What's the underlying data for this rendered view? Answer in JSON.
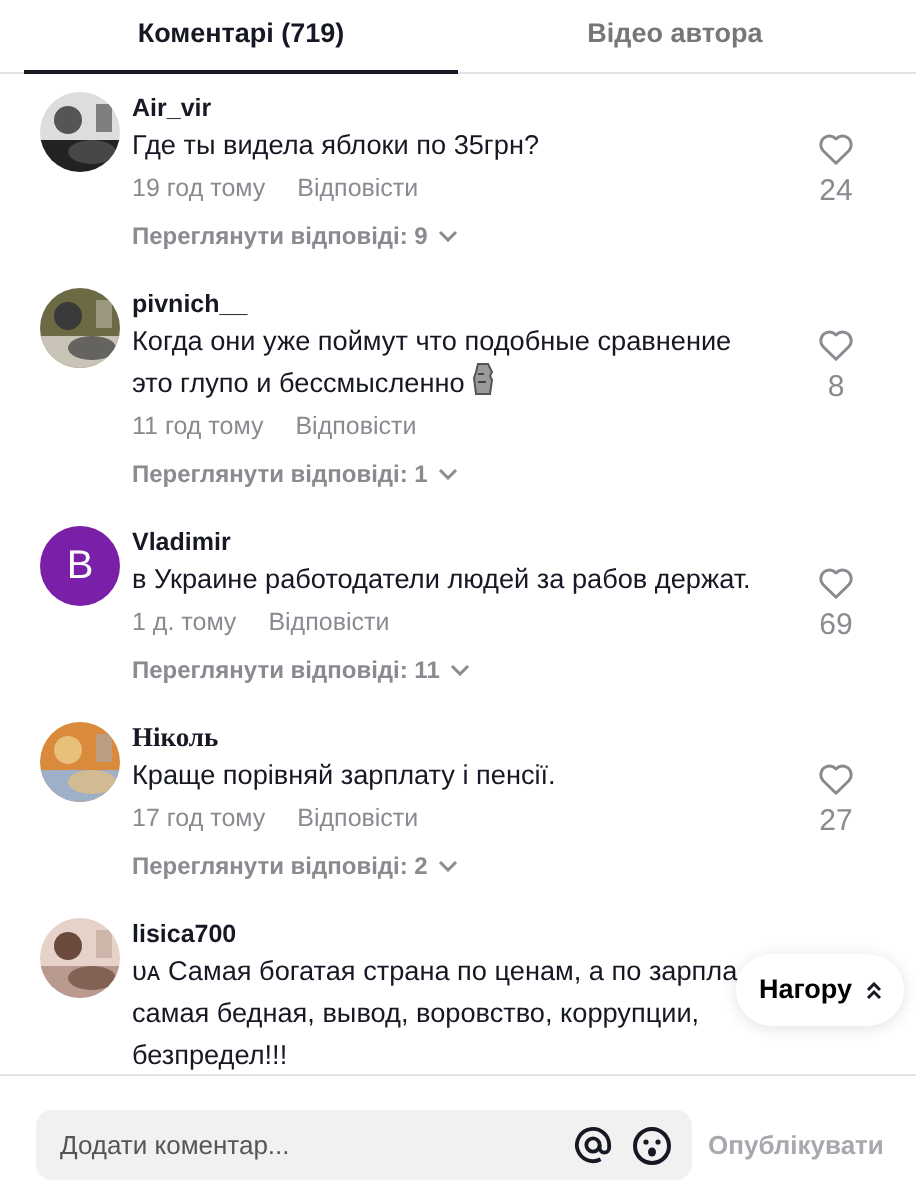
{
  "tabs": [
    {
      "label": "Коментарі (719)",
      "selected": true
    },
    {
      "label": "Відео автора",
      "selected": false
    }
  ],
  "comments": [
    {
      "avatar": {
        "kind": "picture"
      },
      "author": "Air_vir",
      "author_serif": false,
      "lines": [
        "Где ты видела яблоки по 35грн?"
      ],
      "emoji": false,
      "time": "19 год тому",
      "reply": "Відповісти",
      "likes": "24",
      "liked": false,
      "view_replies": "Переглянути відповіді: 9"
    },
    {
      "avatar": {
        "kind": "picture"
      },
      "author": "pivnich__",
      "author_serif": false,
      "lines": [
        "Когда они уже поймут что подобные сравнение",
        "это глупо и бессмысленно"
      ],
      "emoji": true,
      "time": "11 год тому",
      "reply": "Відповісти",
      "likes": "8",
      "liked": false,
      "view_replies": "Переглянути відповіді: 1"
    },
    {
      "avatar": {
        "kind": "letter",
        "letter": "B",
        "color": "#7a1fa8"
      },
      "author": "Vladimir",
      "author_serif": false,
      "lines": [
        "в Украине работодатели людей за рабов держат."
      ],
      "emoji": false,
      "time": "1 д. тому",
      "reply": "Відповісти",
      "likes": "69",
      "liked": false,
      "view_replies": "Переглянути відповіді: 11"
    },
    {
      "avatar": {
        "kind": "picture"
      },
      "author": "Ніколь",
      "author_serif": true,
      "lines": [
        "Краще порівняй зарплату і пенсії."
      ],
      "emoji": false,
      "time": "17 год тому",
      "reply": "Відповісти",
      "likes": "27",
      "liked": false,
      "view_replies": "Переглянути відповіді: 2"
    },
    {
      "avatar": {
        "kind": "picture"
      },
      "author": "lisica700",
      "author_serif": false,
      "lines": [
        "ᴜᴀ Самая богатая страна по ценам, а по зарпла",
        "самая бедная, вывод, воровство, коррупции,",
        "безпредел!!!"
      ],
      "emoji": false
    }
  ],
  "to_top_button": "Нагору",
  "composer": {
    "placeholder": "Додати коментар...",
    "post_button": "Опублікувати"
  }
}
